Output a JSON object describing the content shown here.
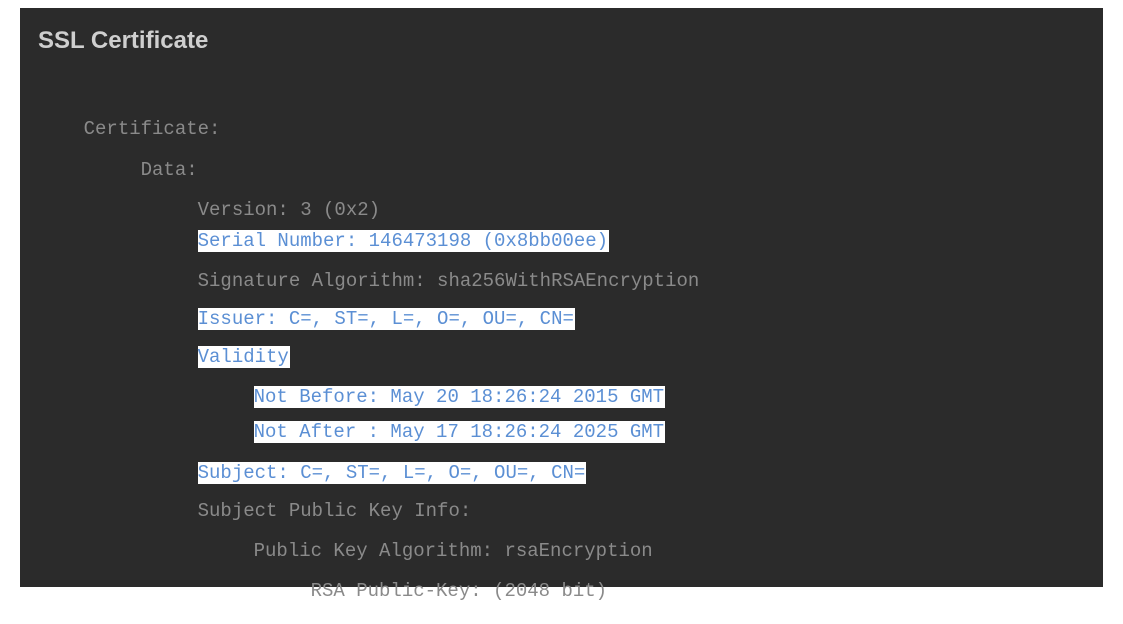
{
  "panel": {
    "title": "SSL Certificate"
  },
  "cert_lines": [
    {
      "text": "Certificate:",
      "indent": 0,
      "highlighted": false
    },
    {
      "text": "Data:",
      "indent": 1,
      "highlighted": false
    },
    {
      "text": "Version: 3 (0x2)",
      "indent": 2,
      "highlighted": false
    },
    {
      "text": "Serial Number: 146473198 (0x8bb00ee)",
      "indent": 2,
      "highlighted": true
    },
    {
      "text": "Signature Algorithm: sha256WithRSAEncryption",
      "indent": 2,
      "highlighted": false
    },
    {
      "text": "Issuer: C=, ST=, L=, O=, OU=, CN=",
      "indent": 2,
      "highlighted": true
    },
    {
      "text": "Validity",
      "indent": 2,
      "highlighted": true
    },
    {
      "text": "Not Before: May 20 18:26:24 2015 GMT",
      "indent": 3,
      "highlighted": true
    },
    {
      "text": "Not After : May 17 18:26:24 2025 GMT",
      "indent": 3,
      "highlighted": true
    },
    {
      "text": "Subject: C=, ST=, L=, O=, OU=, CN=",
      "indent": 2,
      "highlighted": true
    },
    {
      "text": "Subject Public Key Info:",
      "indent": 2,
      "highlighted": false
    },
    {
      "text": "Public Key Algorithm: rsaEncryption",
      "indent": 3,
      "highlighted": false
    },
    {
      "text": "RSA Public-Key: (2048 bit)",
      "indent": 4,
      "highlighted": false
    }
  ],
  "colors": {
    "panel_background": "#2b2b2b",
    "title_text": "#cfcfcf",
    "plain_text": "#8a8a8a",
    "highlight_background": "#ffffff",
    "highlight_text": "#5b8fd4"
  }
}
